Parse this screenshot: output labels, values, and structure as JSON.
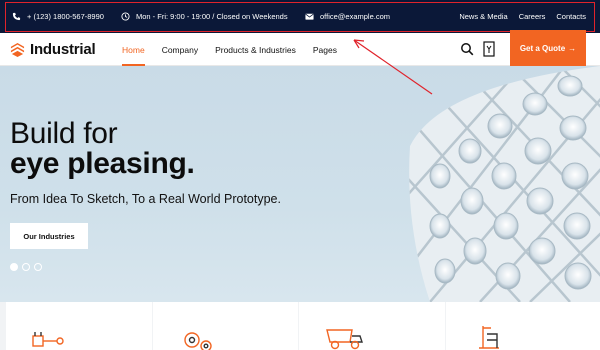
{
  "topbar": {
    "phone": "+ (123) 1800-567-8990",
    "hours": "Mon - Fri: 9:00 - 19:00 / Closed on Weekends",
    "email": "office@example.com",
    "links": [
      "News & Media",
      "Careers",
      "Contacts"
    ]
  },
  "header": {
    "brand": "Industrial",
    "nav": [
      "Home",
      "Company",
      "Products & Industries",
      "Pages"
    ],
    "active_nav": "Home",
    "quote_label": "Get a Quote",
    "quote_arrow": "→"
  },
  "hero": {
    "line1": "Build for",
    "line2": "eye pleasing.",
    "subtitle": "From Idea To Sketch, To a Real World Prototype.",
    "button": "Our Industries",
    "slides": 3,
    "active_slide": 1
  },
  "features": {
    "icons": [
      "piston-icon",
      "gears-icon",
      "dump-truck-icon",
      "oil-rig-icon"
    ]
  },
  "colors": {
    "accent": "#f26522",
    "topbar_bg": "#0b1838",
    "highlight": "#e0232b",
    "hero_bg": "#c9dbe7"
  }
}
